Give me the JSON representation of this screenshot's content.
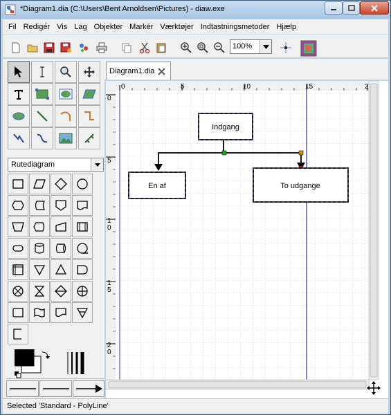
{
  "window": {
    "title": "*Diagram1.dia (C:\\Users\\Bent Arnoldsen\\Pictures) - diaw.exe"
  },
  "menu": [
    "Fil",
    "Redigér",
    "Vis",
    "Lag",
    "Objekter",
    "Markér",
    "Værktøjer",
    "Indtastningsmetoder",
    "Hjælp"
  ],
  "toolbar": {
    "zoom": "100%"
  },
  "sheet": {
    "selected": "Rutediagram"
  },
  "tab": {
    "label": "Diagram1.dia"
  },
  "ruler": {
    "h_ticks": [
      "0",
      "5",
      "10",
      "15",
      "2"
    ],
    "v_ticks": [
      "0",
      "5",
      "1\n0",
      "1\n5",
      "2\n0"
    ]
  },
  "diagram": {
    "boxes": [
      "Indgang",
      "En af",
      "To udgange"
    ]
  },
  "status": {
    "text": "Selected 'Standard - PolyLine'"
  },
  "colors": {
    "guide_line": "#3333aa",
    "handle_green": "#22aa22",
    "handle_orange": "#cc8800",
    "handle_red": "#cc2200"
  }
}
